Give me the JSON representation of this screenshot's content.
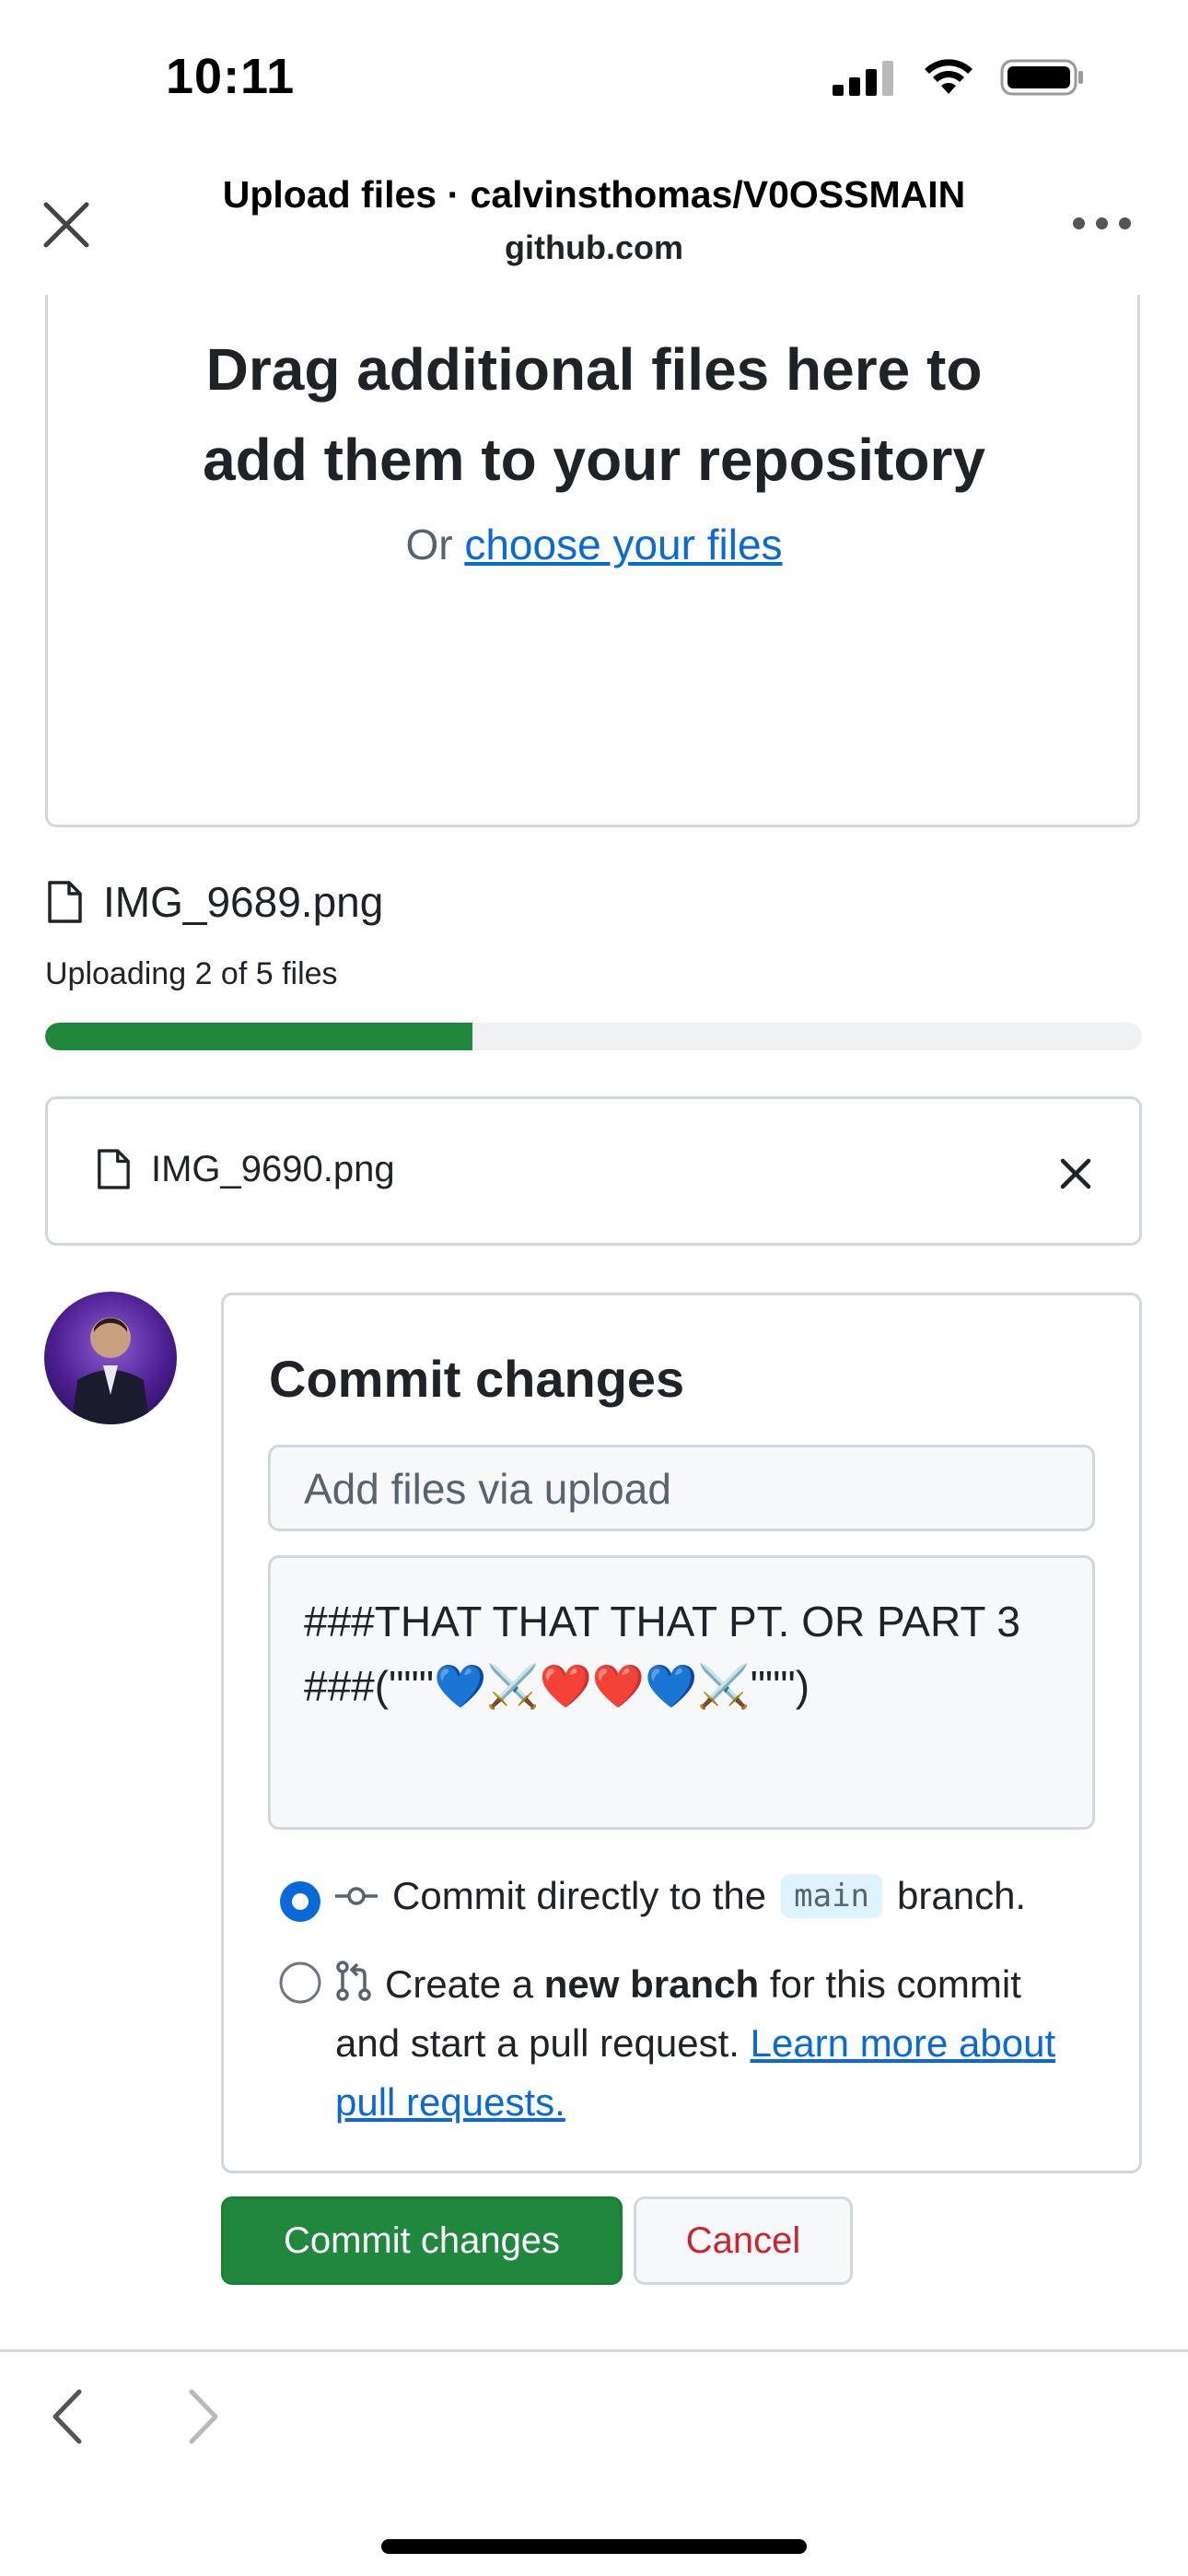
{
  "status_bar": {
    "time": "10:11"
  },
  "browser": {
    "title": "Upload files · calvinsthomas/V0OSSMAIN",
    "domain": "github.com",
    "close_icon": "close-icon",
    "more_icon": "more-icon"
  },
  "dropzone": {
    "heading_line1": "Drag additional files here to",
    "heading_line2": "add them to your repository",
    "or_text": "Or",
    "choose_link": "choose your files"
  },
  "upload": {
    "current_file": "IMG_9689.png",
    "status": "Uploading 2 of 5 files",
    "progress_fraction": 0.39
  },
  "queued_file": {
    "name": "IMG_9690.png"
  },
  "commit": {
    "heading": "Commit changes",
    "summary_placeholder": "Add files via upload",
    "description": "###THAT THAT THAT PT. OR PART 3\n###(\"\"\"💙⚔️❤️❤️💙⚔️\"\"\")",
    "option_direct_prefix": "Commit directly to the",
    "branch_name": "main",
    "option_direct_suffix": "branch.",
    "option_new_prefix": "Create a",
    "option_new_bold": "new branch",
    "option_new_suffix": "for this commit and start a pull request.",
    "learn_more_link": "Learn more about pull requests.",
    "commit_button": "Commit changes",
    "cancel_button": "Cancel"
  },
  "colors": {
    "accent_green": "#1f883d",
    "link_blue": "#0969da",
    "danger_red": "#cf222e",
    "border": "#d0d7de"
  }
}
